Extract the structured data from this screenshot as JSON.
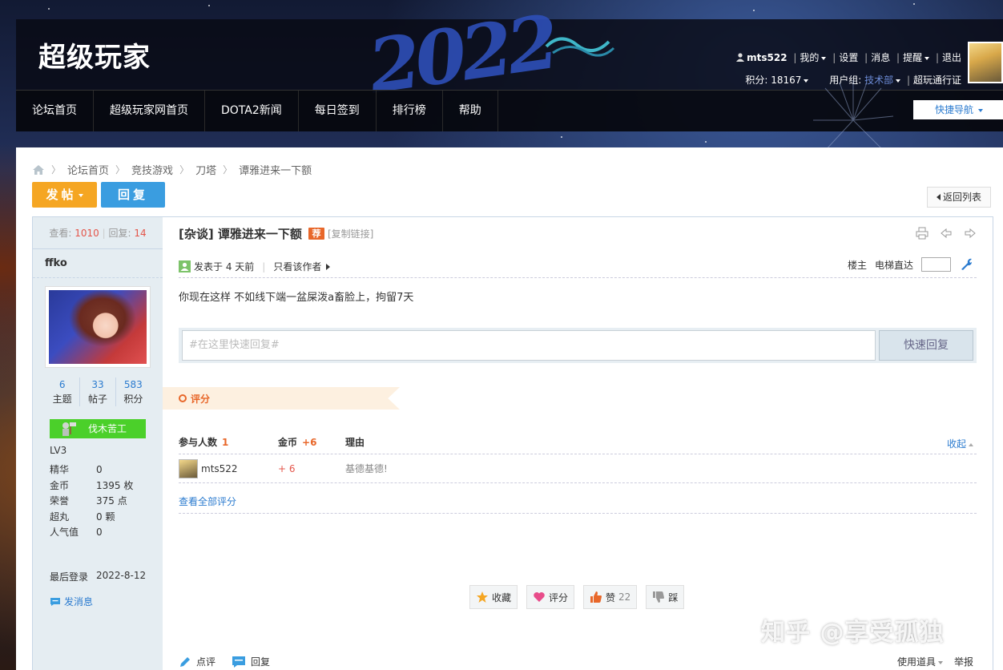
{
  "header": {
    "logo": "超级玩家",
    "year_art": "2022",
    "username": "mts522",
    "menu": [
      "我的",
      "设置",
      "消息",
      "提醒",
      "退出"
    ],
    "points_label": "积分: 18167",
    "usergroup_label": "用户组: ",
    "usergroup_value": "技术部",
    "pass_label": "超玩通行证"
  },
  "nav": {
    "items": [
      "论坛首页",
      "超级玩家网首页",
      "DOTA2新闻",
      "每日签到",
      "排行榜",
      "帮助"
    ],
    "quick_nav": "快捷导航"
  },
  "breadcrumb": [
    "论坛首页",
    "竞技游戏",
    "刀塔",
    "谭雅进来一下额"
  ],
  "buttons": {
    "post": "发帖",
    "reply": "回复",
    "back": "返回列表"
  },
  "sidebar": {
    "views_label": "查看: ",
    "views": "1010",
    "replies_label": "回复: ",
    "replies": "14",
    "name": "ffko",
    "counts": [
      {
        "n": "6",
        "l": "主题"
      },
      {
        "n": "33",
        "l": "帖子"
      },
      {
        "n": "583",
        "l": "积分"
      }
    ],
    "badge": "伐木苦工",
    "level": "LV3",
    "info": [
      {
        "k": "精华",
        "v": "0"
      },
      {
        "k": "金币",
        "v": "1395 枚"
      },
      {
        "k": "荣誉",
        "v": "375 点"
      },
      {
        "k": "超丸",
        "v": "0 颗"
      },
      {
        "k": "人气值",
        "v": "0"
      }
    ],
    "last_login_label": "最后登录",
    "last_login": "2022-8-12",
    "send_msg": "发消息"
  },
  "post": {
    "title": "[杂谈] 谭雅进来一下额",
    "rec": "荐",
    "copy_link": "[复制链接]",
    "posted": "发表于 4 天前",
    "only_author": "只看该作者",
    "floor": "楼主",
    "elevator": "电梯直达",
    "body": "你现在这样 不如线下端一盆屎泼a畜脸上，拘留7天",
    "quick_reply_placeholder": "#在这里快速回复#",
    "quick_reply_btn": "快速回复"
  },
  "rating": {
    "band": "评分",
    "head_participants": "参与人数",
    "participants": "1",
    "head_gold": "金币",
    "gold_total": "+6",
    "head_reason": "理由",
    "collapse": "收起",
    "rows": [
      {
        "user": "mts522",
        "gold": "+ 6",
        "reason": "基德基德!"
      }
    ],
    "view_all": "查看全部评分"
  },
  "actions": {
    "fav": "收藏",
    "rate": "评分",
    "like": "赞",
    "like_count": "22",
    "dislike": "踩"
  },
  "footer": {
    "comment": "点评",
    "reply": "回复",
    "tools": "使用道具",
    "report": "举报"
  },
  "watermark": "知乎 @享受孤独",
  "colors": {
    "accent_orange": "#f5a623",
    "accent_blue": "#3a9de0",
    "link": "#2b7bcf",
    "red": "#e4554a",
    "green_badge": "#4bd02a"
  }
}
